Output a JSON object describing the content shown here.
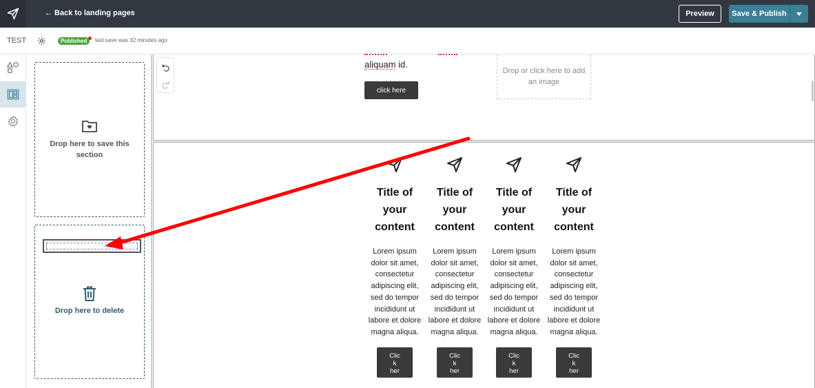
{
  "topbar": {
    "back_label": "← Back to landing pages",
    "preview_label": "Preview",
    "publish_label": "Save & Publish"
  },
  "subbar": {
    "page_name": "TEST",
    "status": "Published",
    "last_save": "last save was 32 minutes ago"
  },
  "panel": {
    "save_zone_label": "Drop here to save this section",
    "delete_zone_label": "Drop here to delete"
  },
  "canvas": {
    "section1": {
      "text_fragment": "aliquam id.",
      "button_label": "click here",
      "image_placeholder": "Drop or click here to add an image"
    },
    "columns": [
      {
        "title": "Title of your content",
        "body": "Lorem ipsum dolor sit amet, consectetur adipiscing elit, sed do tempor incididunt ut labore et dolore magna aliqua.",
        "button": "Clic\nk\nher"
      },
      {
        "title": "Title of your content",
        "body": "Lorem ipsum dolor sit amet, consectetur adipiscing elit, sed do tempor incididunt ut labore et dolore magna aliqua.",
        "button": "Clic\nk\nher"
      },
      {
        "title": "Title of your content",
        "body": "Lorem ipsum dolor sit amet, consectetur adipiscing elit, sed do tempor incididunt ut labore et dolore magna aliqua.",
        "button": "Clic\nk\nher"
      },
      {
        "title": "Title of your content",
        "body": "Lorem ipsum dolor sit amet, consectetur adipiscing elit, sed do tempor incididunt ut labore et dolore magna aliqua.",
        "button": "Clic\nk\nher"
      }
    ]
  },
  "colors": {
    "topbar": "#323840",
    "accent": "#3b7f97",
    "published": "#4ea33a",
    "annotation_arrow": "#ff0000"
  },
  "icons": {
    "logo": "paper-plane-icon",
    "rail": [
      "shapes-icon",
      "layout-blocks-icon",
      "gear-icon"
    ],
    "save_zone": "folder-heart-icon",
    "delete_zone": "trash-icon",
    "column": "paper-plane-icon"
  }
}
